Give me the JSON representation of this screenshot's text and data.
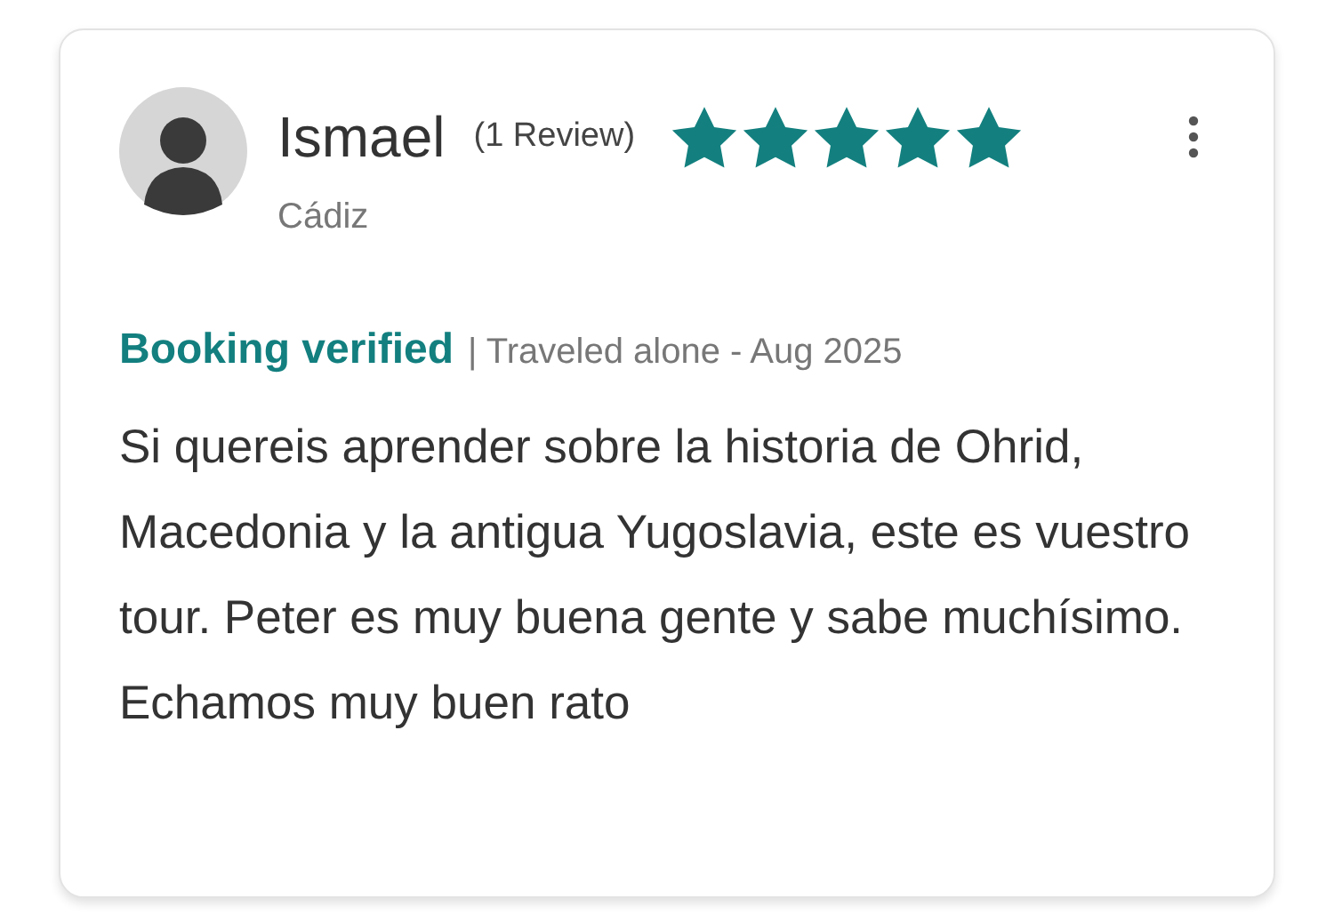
{
  "review": {
    "author": "Ismael",
    "review_count": "(1 Review)",
    "stars": 5,
    "location": "Cádiz",
    "verified_label": "Booking verified",
    "trip_info": "| Traveled alone - Aug 2025",
    "text": "Si quereis aprender sobre la historia de Ohrid, Macedonia y la antigua Yugoslavia, este es vuestro tour. Peter es muy buena gente y sabe muchísimo. Echamos muy buen rato"
  }
}
